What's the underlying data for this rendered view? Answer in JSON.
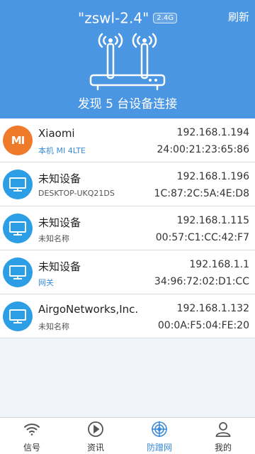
{
  "header": {
    "ssid": "\"zswl-2.4\"",
    "band_badge": "2.4G",
    "refresh_label": "刷新",
    "found_text": "发现 5 台设备连接"
  },
  "devices": [
    {
      "icon": "xiaomi-logo-icon",
      "logo_text": "MI",
      "name": "Xiaomi",
      "sub": "本机 MI 4LTE",
      "sub_color": "#3c8bd8",
      "ip": "192.168.1.194",
      "mac": "24:00:21:23:65:86"
    },
    {
      "icon": "computer-icon",
      "name": "未知设备",
      "sub": "DESKTOP-UKQ21DS",
      "ip": "192.168.1.196",
      "mac": "1C:87:2C:5A:4E:D8"
    },
    {
      "icon": "computer-icon",
      "name": "未知设备",
      "sub": "未知名称",
      "ip": "192.168.1.115",
      "mac": "00:57:C1:CC:42:F7"
    },
    {
      "icon": "computer-icon",
      "name": "未知设备",
      "sub": "网关",
      "sub_color": "#3c8bd8",
      "ip": "192.168.1.1",
      "mac": "34:96:72:02:D1:CC"
    },
    {
      "icon": "computer-icon",
      "name": "AirgoNetworks,Inc.",
      "sub": "未知名称",
      "ip": "192.168.1.132",
      "mac": "00:0A:F5:04:FE:20"
    }
  ],
  "tabs": [
    {
      "label": "信号",
      "icon": "wifi-signal-icon"
    },
    {
      "label": "资讯",
      "icon": "play-circle-icon"
    },
    {
      "label": "防蹭网",
      "icon": "radar-icon",
      "active": true
    },
    {
      "label": "我的",
      "icon": "user-icon"
    }
  ],
  "colors": {
    "header": "#4a96e2",
    "accent": "#3c8bd8",
    "xiaomi": "#ee7a2a",
    "device": "#2b9ee6"
  }
}
